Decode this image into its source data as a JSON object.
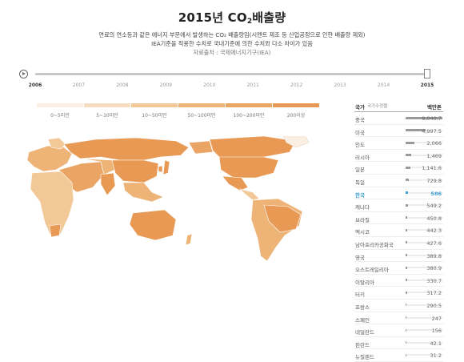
{
  "header": {
    "title_main": "2015년 CO",
    "title_sub": "2",
    "title_tail": "배출량",
    "desc_line1": "연료의 연소등과 같은 에너지 부문에서 발생하는 CO₂ 배출량임(시멘트 제조 등 산업공정으로 인한 배출량 제외)",
    "desc_line2": "IEA기준을 적용한 수치로 국내기준에 의한 수치와 다소 차이가 있음",
    "source": "자료출처 : 국제에너지기구(IEA)"
  },
  "timeline": {
    "years": [
      "2006",
      "2007",
      "2008",
      "2009",
      "2010",
      "2011",
      "2012",
      "2013",
      "2014",
      "2015"
    ],
    "selected_year": "2015",
    "start_year": "2006"
  },
  "legend": [
    {
      "label": "0~5미만",
      "color": "#fbefe4"
    },
    {
      "label": "5~10미만",
      "color": "#f7dcc0"
    },
    {
      "label": "10~50미만",
      "color": "#f2c897"
    },
    {
      "label": "50~100미만",
      "color": "#eeb377"
    },
    {
      "label": "100~200미만",
      "color": "#eaa564"
    },
    {
      "label": "200이상",
      "color": "#e89a55"
    }
  ],
  "panel": {
    "col_country": "국가",
    "sort_label": "국가수정렬",
    "col_unit": "백만톤",
    "max": 9040.7,
    "highlight_color": "#3fa0d6",
    "rows": [
      {
        "name": "중국",
        "value": 9040.7,
        "display": "9,040.7"
      },
      {
        "name": "미국",
        "value": 4997.5,
        "display": "4,997.5"
      },
      {
        "name": "인도",
        "value": 2066,
        "display": "2,066"
      },
      {
        "name": "러시아",
        "value": 1469,
        "display": "1,469"
      },
      {
        "name": "일본",
        "value": 1141.6,
        "display": "1,141.6"
      },
      {
        "name": "독일",
        "value": 729.8,
        "display": "729.8"
      },
      {
        "name": "한국",
        "value": 586,
        "display": "586",
        "highlight": true
      },
      {
        "name": "캐나다",
        "value": 549.2,
        "display": "549.2"
      },
      {
        "name": "브라질",
        "value": 450.8,
        "display": "450.8"
      },
      {
        "name": "멕시코",
        "value": 442.3,
        "display": "442.3"
      },
      {
        "name": "남아프리카공화국",
        "value": 427.6,
        "display": "427.6"
      },
      {
        "name": "영국",
        "value": 389.8,
        "display": "389.8"
      },
      {
        "name": "오스트레일리아",
        "value": 380.9,
        "display": "380.9"
      },
      {
        "name": "이탈리아",
        "value": 330.7,
        "display": "330.7"
      },
      {
        "name": "터키",
        "value": 317.2,
        "display": "317.2"
      },
      {
        "name": "프랑스",
        "value": 290.5,
        "display": "290.5"
      },
      {
        "name": "스페인",
        "value": 247,
        "display": "247"
      },
      {
        "name": "네덜란드",
        "value": 156,
        "display": "156"
      },
      {
        "name": "핀란드",
        "value": 42.1,
        "display": "42.1"
      },
      {
        "name": "뉴질랜드",
        "value": 31.2,
        "display": "31.2"
      }
    ]
  }
}
